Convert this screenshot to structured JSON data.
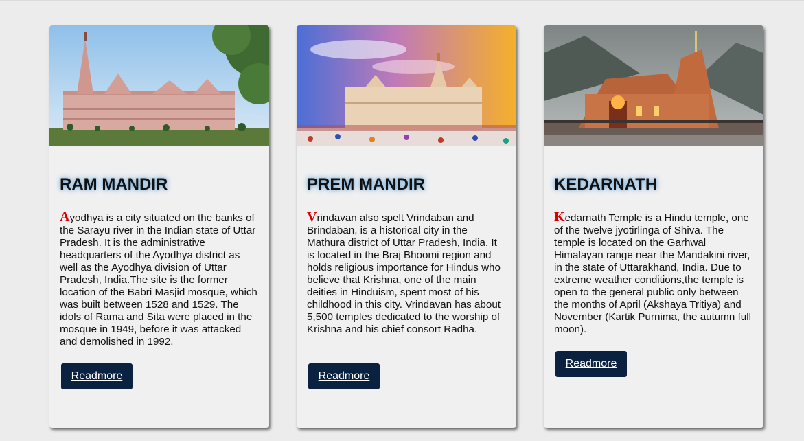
{
  "cards": [
    {
      "title": "RAM MANDIR",
      "first_letter": "A",
      "text": "yodhya is a city situated on the banks of the Sarayu river in the Indian state of Uttar Pradesh. It is the administrative headquarters of the Ayodhya district as well as the Ayodhya division of Uttar Pradesh, India.The site is the former location of the Babri Masjid mosque, which was built between 1528 and 1529. The idols of Rama and Sita were placed in the mosque in 1949, before it was attacked and demolished in 1992.",
      "button": "Readmore"
    },
    {
      "title": "PREM MANDIR",
      "first_letter": "V",
      "text": "rindavan also spelt Vrindaban and Brindaban, is a historical city in the Mathura district of Uttar Pradesh, India. It is located in the Braj Bhoomi region and holds religious importance for Hindus who believe that Krishna, one of the main deities in Hinduism, spent most of his childhood in this city. Vrindavan has about 5,500 temples dedicated to the worship of Krishna and his chief consort Radha.",
      "button": "Readmore"
    },
    {
      "title": "KEDARNATH",
      "first_letter": "K",
      "text": "edarnath Temple is a Hindu temple, one of the twelve jyotirlinga of Shiva. The temple is located on the Garhwal Himalayan range near the Mandakini river, in the state of Uttarakhand, India. Due to extreme weather conditions,the temple is open to the general public only between the months of April (Akshaya Tritiya) and November (Kartik Purnima, the autumn full moon).",
      "button": "Readmore"
    }
  ],
  "colors": {
    "page_background": "#ececec",
    "card_background": "#f0f0f0",
    "button_background": "#0b2140",
    "drop_cap": "#d60000",
    "title_glow": "#6fa7d6"
  }
}
